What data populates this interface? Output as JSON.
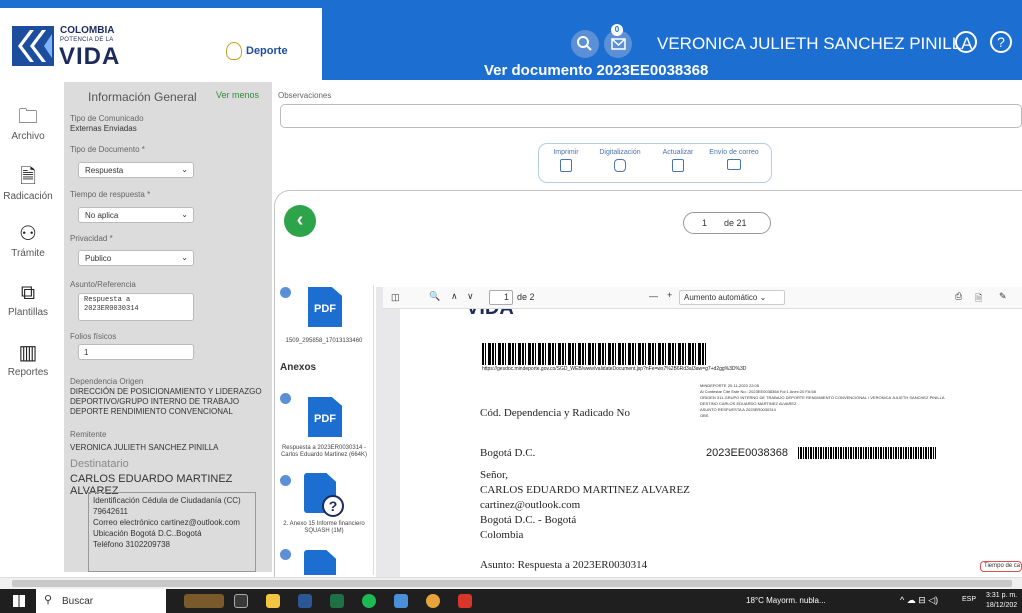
{
  "header": {
    "logo_country": "COLOMBIA",
    "logo_tagline": "POTENCIA DE LA",
    "logo_vida": "VIDA",
    "deporte_label": "Deporte",
    "mail_badge": "0",
    "user_name": "VERONICA JULIETH SANCHEZ PINILLA",
    "help_glyph": "?",
    "doc_title": "Ver documento 2023EE0038368",
    "brand_color": "#1c6fd0"
  },
  "rail": [
    {
      "label": "Archivo",
      "icon": "folder-icon",
      "glyph": "🗀"
    },
    {
      "label": "Radicación",
      "icon": "document-icon",
      "glyph": "🗎"
    },
    {
      "label": "Trámite",
      "icon": "flow-icon",
      "glyph": "⚇"
    },
    {
      "label": "Plantillas",
      "icon": "templates-icon",
      "glyph": "⧉"
    },
    {
      "label": "Reportes",
      "icon": "reports-icon",
      "glyph": "▥"
    }
  ],
  "info": {
    "title": "Información General",
    "ver_menos": "Ver menos",
    "tipo_comunicado_label": "Tipo de Comunicado",
    "tipo_comunicado_value": "Externas Enviadas",
    "tipo_documento_label": "Tipo de Documento *",
    "tipo_documento_value": "Respuesta",
    "tiempo_label": "Tiempo de respuesta *",
    "tiempo_value": "No aplica",
    "privacidad_label": "Privacidad *",
    "privacidad_value": "Publico",
    "asunto_label": "Asunto/Referencia",
    "asunto_value": "Respuesta a 2023ER0030314",
    "folios_label": "Folios físicos",
    "folios_value": "1",
    "dependencia_label": "Dependencia Origen",
    "dependencia_value": "DIRECCIÓN DE POSICIONAMIENTO Y LIDERAZGO DEPORTIVO/GRUPO INTERNO DE TRABAJO DEPORTE RENDIMIENTO CONVENCIONAL",
    "remitente_label": "Remitente",
    "remitente_value": "VERONICA JULIETH SANCHEZ PINILLA",
    "destinatario_label": "Destinatario",
    "destinatario_value": "CARLOS EDUARDO MARTINEZ ALVAREZ",
    "dest_identificacion_label": "Identificación",
    "dest_identificacion_value": "Cédula de Ciudadanía (CC) 79642611",
    "dest_email_label": "Correo electrónico",
    "dest_email_value": "cartinez@outlook.com",
    "dest_ubicacion_label": "Ubicación",
    "dest_ubicacion_value": "Bogotá D.C..Bogotá",
    "dest_telefono_label": "Teléfono",
    "dest_telefono_value": "3102209738"
  },
  "main": {
    "observaciones_label": "Observaciones",
    "toolbar": [
      {
        "label": "Imprimir",
        "icon": "print-icon"
      },
      {
        "label": "Digitalización",
        "icon": "camera-icon"
      },
      {
        "label": "Actualizar",
        "icon": "refresh-icon"
      },
      {
        "label": "Envío de correo",
        "icon": "mail-icon"
      }
    ],
    "pager_current": "1",
    "pager_of": "de 21"
  },
  "attachments": {
    "first_name": "1509_295858_17013133460",
    "anexos_label": "Anexos",
    "items": [
      {
        "num": "2",
        "name": "Respuesta a 2023ER0030314 - Carlos Eduardo Martinez (664K)",
        "icon": "PDF"
      },
      {
        "num": "3",
        "name": "2. Anexo 15 Informe financiero SQUASH (1M)",
        "icon": "?"
      },
      {
        "num": "4",
        "name": "",
        "icon": "?"
      }
    ]
  },
  "pdf": {
    "page_current": "1",
    "page_total": "de 2",
    "zoom": "Aumento automático",
    "logo_partial": "VIDA",
    "validation_url": "https://gesdoc.mindeporte.gov.co/SGD_WEB/www/validateDocument.jsp?nFe=ws7%2B6Rd3aI3aw=g7+d2gg%3D%3D",
    "header_block": "MINDEPORTE 20-11-2023 22:05\nAl Contestar Cite Este No.: 2023EE0038368 Fol:1 Anex:20 FA:58\nORIGEN 311-GRUPO INTERNO DE TRABAJO DEPORTE RENDIMIENTO CONVENCIONAL / VERONICA JULIETH SANCHEZ PINILLA\nDESTINO CARLOS EDUARDO MARTINEZ ALVAREZ\nASUNTO RESPUESTA A 2023ER0030314\nOBS",
    "cod_label": "Cód. Dependencia y Radicado No",
    "city": "Bogotá D.C.",
    "radicado": "2023EE0038368",
    "senor": "Señor,",
    "recipient": "CARLOS EDUARDO MARTINEZ ALVAREZ",
    "email": "cartinez@outlook.com",
    "location": "Bogotá D.C. - Bogotá",
    "country": "Colombia",
    "asunto": "Asunto: Respuesta a 2023ER0030314",
    "tiempo_badge": "Tiempo de ca"
  },
  "taskbar": {
    "search_label": "Buscar",
    "weather": "18°C Mayorm. nubla...",
    "lang": "ESP",
    "time": "3:31 p. m.",
    "date": "18/12/202"
  }
}
